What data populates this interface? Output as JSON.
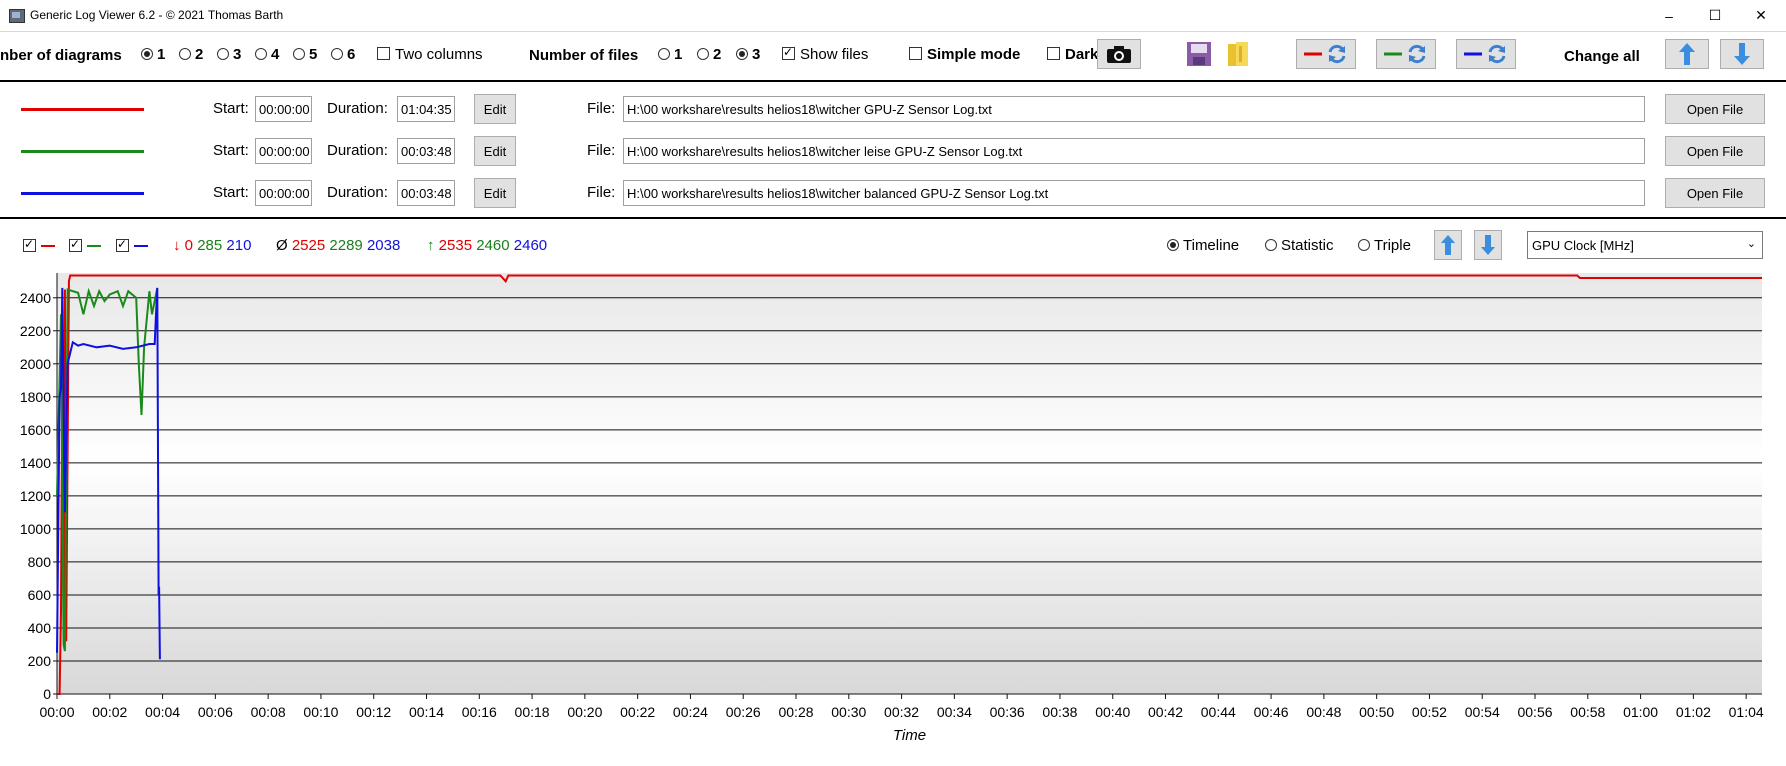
{
  "window": {
    "title": "Generic Log Viewer 6.2 - © 2021 Thomas Barth",
    "minimize": "–",
    "maximize": "☐",
    "close": "✕"
  },
  "toolbar": {
    "num_diagrams_label": "nber of diagrams",
    "diagram_options": [
      "1",
      "2",
      "3",
      "4",
      "5",
      "6"
    ],
    "diagram_selected": "1",
    "two_columns_label": "Two columns",
    "two_columns_checked": false,
    "num_files_label": "Number of files",
    "file_options": [
      "1",
      "2",
      "3"
    ],
    "files_selected": "3",
    "show_files_label": "Show files",
    "show_files_checked": true,
    "simple_mode_label": "Simple mode",
    "simple_mode_checked": false,
    "dark_label": "Dark",
    "dark_checked": false,
    "change_all_label": "Change all"
  },
  "files": [
    {
      "color": "#e00000",
      "start_label": "Start:",
      "start": "00:00:00",
      "duration_label": "Duration:",
      "duration": "01:04:35",
      "edit": "Edit",
      "file_label": "File:",
      "path": "H:\\00 workshare\\results helios18\\witcher GPU-Z Sensor Log.txt",
      "open": "Open File"
    },
    {
      "color": "#1a8a1a",
      "start_label": "Start:",
      "start": "00:00:00",
      "duration_label": "Duration:",
      "duration": "00:03:48",
      "edit": "Edit",
      "file_label": "File:",
      "path": "H:\\00 workshare\\results helios18\\witcher leise GPU-Z Sensor Log.txt",
      "open": "Open File"
    },
    {
      "color": "#1010e0",
      "start_label": "Start:",
      "start": "00:00:00",
      "duration_label": "Duration:",
      "duration": "00:03:48",
      "edit": "Edit",
      "file_label": "File:",
      "path": "H:\\00 workshare\\results helios18\\witcher balanced GPU-Z Sensor Log.txt",
      "open": "Open File"
    }
  ],
  "stats": {
    "min_symbol": "↓",
    "min": [
      "0",
      "285",
      "210"
    ],
    "avg_symbol": "Ø",
    "avg": [
      "2525",
      "2289",
      "2038"
    ],
    "max_symbol": "↑",
    "max": [
      "2535",
      "2460",
      "2460"
    ]
  },
  "view": {
    "timeline_label": "Timeline",
    "statistic_label": "Statistic",
    "triple_label": "Triple",
    "selected": "Timeline",
    "sensor_select": "GPU Clock [MHz]"
  },
  "chart_data": {
    "type": "line",
    "xlabel": "Time",
    "ylabel": "",
    "ylim": [
      0,
      2550
    ],
    "xlim_minutes": [
      0,
      64.6
    ],
    "yticks": [
      "0",
      "200",
      "400",
      "600",
      "800",
      "1000",
      "1200",
      "1400",
      "1600",
      "1800",
      "2000",
      "2200",
      "2400"
    ],
    "xticks": [
      "00:00",
      "00:02",
      "00:04",
      "00:06",
      "00:08",
      "00:10",
      "00:12",
      "00:14",
      "00:16",
      "00:18",
      "00:20",
      "00:22",
      "00:24",
      "00:26",
      "00:28",
      "00:30",
      "00:32",
      "00:34",
      "00:36",
      "00:38",
      "00:40",
      "00:42",
      "00:44",
      "00:46",
      "00:48",
      "00:50",
      "00:52",
      "00:54",
      "00:56",
      "00:58",
      "01:00",
      "01:02",
      "01:04"
    ],
    "grid": true,
    "series": [
      {
        "color": "#e00000",
        "points": [
          [
            0,
            0
          ],
          [
            0.1,
            0
          ],
          [
            0.15,
            500
          ],
          [
            0.2,
            2000
          ],
          [
            0.25,
            400
          ],
          [
            0.3,
            2450
          ],
          [
            0.35,
            320
          ],
          [
            0.45,
            2500
          ],
          [
            0.5,
            2535
          ],
          [
            16.8,
            2535
          ],
          [
            17.0,
            2500
          ],
          [
            17.1,
            2535
          ],
          [
            57.6,
            2535
          ],
          [
            57.7,
            2520
          ],
          [
            64.6,
            2520
          ]
        ]
      },
      {
        "color": "#1a8a1a",
        "points": [
          [
            0,
            1200
          ],
          [
            0.15,
            2300
          ],
          [
            0.25,
            300
          ],
          [
            0.3,
            260
          ],
          [
            0.4,
            2450
          ],
          [
            0.8,
            2430
          ],
          [
            1.0,
            2300
          ],
          [
            1.2,
            2440
          ],
          [
            1.4,
            2350
          ],
          [
            1.6,
            2440
          ],
          [
            1.8,
            2380
          ],
          [
            2.0,
            2420
          ],
          [
            2.3,
            2440
          ],
          [
            2.5,
            2350
          ],
          [
            2.7,
            2440
          ],
          [
            3.0,
            2400
          ],
          [
            3.1,
            2000
          ],
          [
            3.2,
            1690
          ],
          [
            3.3,
            2100
          ],
          [
            3.5,
            2440
          ],
          [
            3.6,
            2300
          ],
          [
            3.8,
            2460
          ]
        ]
      },
      {
        "color": "#1010e0",
        "points": [
          [
            0,
            250
          ],
          [
            0.1,
            1800
          ],
          [
            0.15,
            1850
          ],
          [
            0.2,
            2460
          ],
          [
            0.3,
            1100
          ],
          [
            0.4,
            2000
          ],
          [
            0.6,
            2130
          ],
          [
            0.8,
            2110
          ],
          [
            1.0,
            2120
          ],
          [
            1.5,
            2100
          ],
          [
            2.0,
            2110
          ],
          [
            2.5,
            2090
          ],
          [
            3.0,
            2100
          ],
          [
            3.5,
            2120
          ],
          [
            3.7,
            2120
          ],
          [
            3.75,
            2300
          ],
          [
            3.8,
            2460
          ],
          [
            3.85,
            600
          ],
          [
            3.87,
            650
          ],
          [
            3.9,
            210
          ]
        ]
      }
    ]
  }
}
